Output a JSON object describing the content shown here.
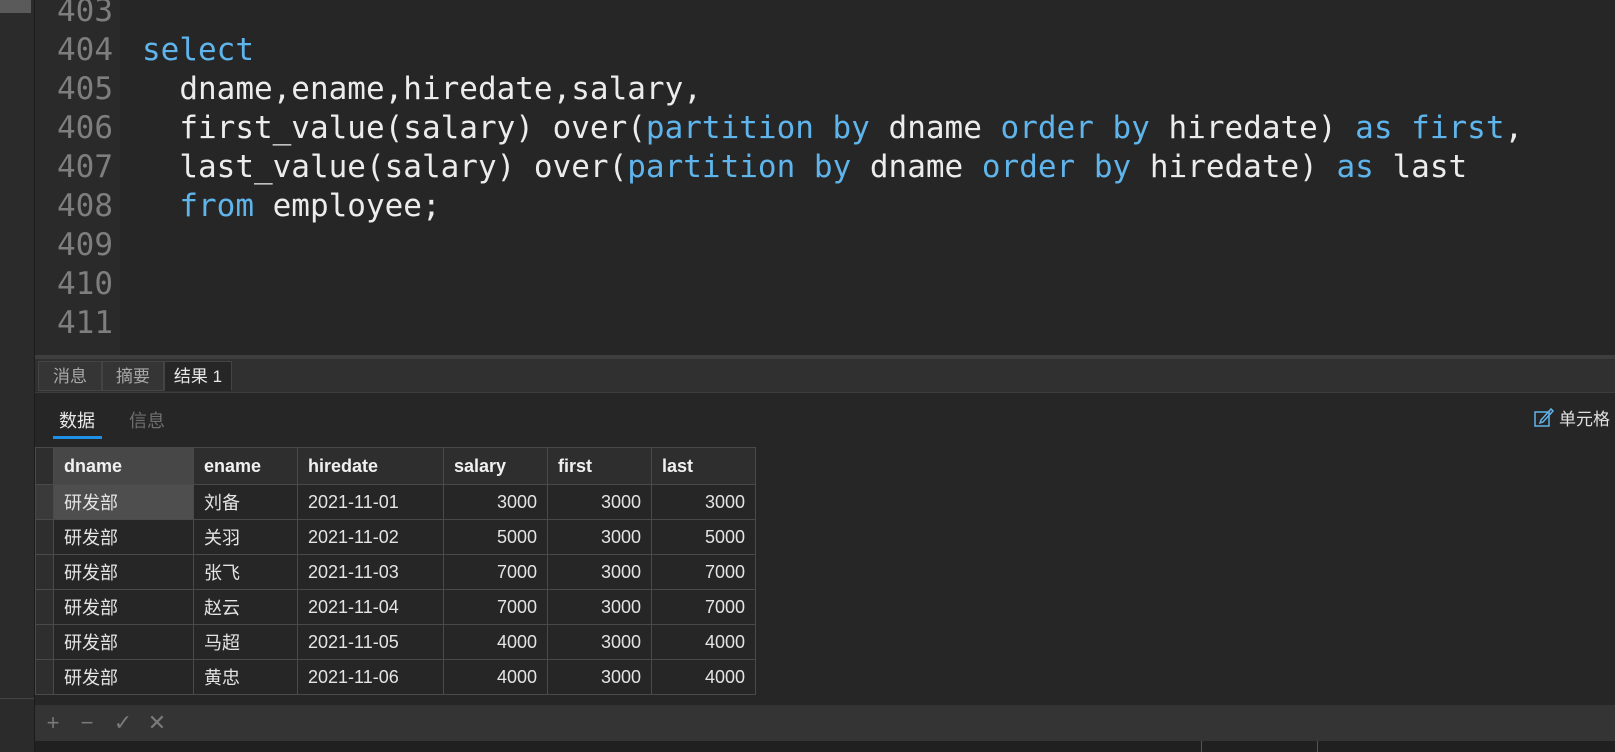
{
  "colors": {
    "keyword": "#5fb4eb",
    "identifier": "#ececec",
    "line_number": "#7e7e7e",
    "accent": "#1e90e6"
  },
  "editor": {
    "lines": [
      {
        "n": "403",
        "segs": []
      },
      {
        "n": "404",
        "segs": [
          {
            "t": "select",
            "k": true
          }
        ]
      },
      {
        "n": "405",
        "segs": [
          {
            "t": "  dname,ename,hiredate,salary,",
            "k": false
          }
        ]
      },
      {
        "n": "406",
        "segs": [
          {
            "t": "  first_value(salary) over(",
            "k": false
          },
          {
            "t": "partition by",
            "k": true
          },
          {
            "t": " dname ",
            "k": false
          },
          {
            "t": "order by",
            "k": true
          },
          {
            "t": " hiredate) ",
            "k": false
          },
          {
            "t": "as first",
            "k": true
          },
          {
            "t": ",",
            "k": false
          }
        ]
      },
      {
        "n": "407",
        "segs": [
          {
            "t": "  last_value(salary) over(",
            "k": false
          },
          {
            "t": "partition by",
            "k": true
          },
          {
            "t": " dname ",
            "k": false
          },
          {
            "t": "order by",
            "k": true
          },
          {
            "t": " hiredate) ",
            "k": false
          },
          {
            "t": "as",
            "k": true
          },
          {
            "t": " last",
            "k": false
          }
        ]
      },
      {
        "n": "408",
        "segs": [
          {
            "t": "  ",
            "k": false
          },
          {
            "t": "from",
            "k": true
          },
          {
            "t": " employee;",
            "k": false
          }
        ]
      },
      {
        "n": "409",
        "segs": []
      },
      {
        "n": "410",
        "segs": []
      },
      {
        "n": "411",
        "segs": []
      }
    ]
  },
  "result_tabs": [
    {
      "label": "消息",
      "active": false
    },
    {
      "label": "摘要",
      "active": false
    },
    {
      "label": "结果 1",
      "active": true
    }
  ],
  "sub_tabs": {
    "data": "数据",
    "info": "信息"
  },
  "cell_edit_label": "单元格",
  "table": {
    "columns": [
      "dname",
      "ename",
      "hiredate",
      "salary",
      "first",
      "last"
    ],
    "rows": [
      [
        "研发部",
        "刘备",
        "2021-11-01",
        "3000",
        "3000",
        "3000"
      ],
      [
        "研发部",
        "关羽",
        "2021-11-02",
        "5000",
        "3000",
        "5000"
      ],
      [
        "研发部",
        "张飞",
        "2021-11-03",
        "7000",
        "3000",
        "7000"
      ],
      [
        "研发部",
        "赵云",
        "2021-11-04",
        "7000",
        "3000",
        "7000"
      ],
      [
        "研发部",
        "马超",
        "2021-11-05",
        "4000",
        "3000",
        "4000"
      ],
      [
        "研发部",
        "黄忠",
        "2021-11-06",
        "4000",
        "3000",
        "4000"
      ]
    ]
  },
  "toolbar": {
    "add": "+",
    "remove": "−",
    "apply": "✓",
    "cancel": "✕"
  }
}
